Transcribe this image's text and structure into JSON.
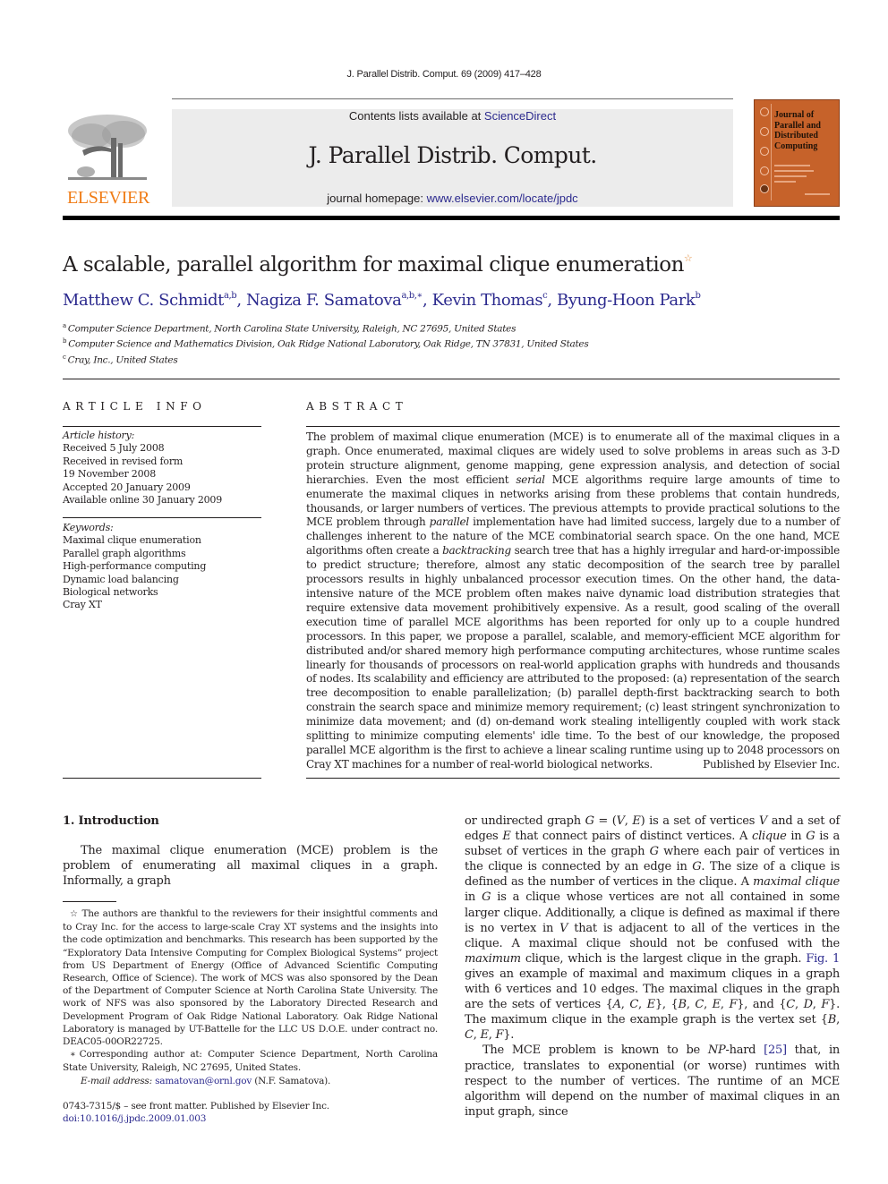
{
  "header": {
    "running_head": "J. Parallel Distrib. Comput. 69 (2009) 417–428",
    "contents_prefix": "Contents lists available at ",
    "contents_link": "ScienceDirect",
    "journal_title": "J. Parallel Distrib. Comput.",
    "homepage_prefix": "journal homepage: ",
    "homepage_link": "www.elsevier.com/locate/jpdc",
    "publisher_logo_text": "ELSEVIER",
    "cover_title_lines": [
      "Journal of",
      "Parallel and",
      "Distributed",
      "Computing"
    ]
  },
  "colors": {
    "link": "#2c2a8e",
    "elsevier_orange": "#f07c16",
    "cover_orange": "#c6622a",
    "banner_gray": "#ececec"
  },
  "article": {
    "title": "A scalable, parallel algorithm for maximal clique enumeration",
    "title_note_mark": "☆",
    "authors": [
      {
        "name": "Matthew C. Schmidt",
        "sup": "a,b"
      },
      {
        "name": "Nagiza F. Samatova",
        "sup": "a,b,∗"
      },
      {
        "name": "Kevin Thomas",
        "sup": "c"
      },
      {
        "name": "Byung-Hoon Park",
        "sup": "b"
      }
    ],
    "author_separator": ", ",
    "affiliations": [
      {
        "mark": "a",
        "text": "Computer Science Department, North Carolina State University, Raleigh, NC 27695, United States"
      },
      {
        "mark": "b",
        "text": "Computer Science and Mathematics Division, Oak Ridge National Laboratory, Oak Ridge, TN 37831, United States"
      },
      {
        "mark": "c",
        "text": "Cray, Inc., United States"
      }
    ]
  },
  "article_info": {
    "heading": "ARTICLE INFO",
    "history_label": "Article history:",
    "history": [
      "Received 5 July 2008",
      "Received in revised form",
      "19 November 2008",
      "Accepted 20 January 2009",
      "Available online 30 January 2009"
    ],
    "keywords_label": "Keywords:",
    "keywords": [
      "Maximal clique enumeration",
      "Parallel graph algorithms",
      "High-performance computing",
      "Dynamic load balancing",
      "Biological networks",
      "Cray XT"
    ]
  },
  "abstract": {
    "heading": "ABSTRACT",
    "segments": [
      {
        "t": "The problem of maximal clique enumeration (MCE) is to enumerate all of the maximal cliques in a graph. Once enumerated, maximal cliques are widely used to solve problems in areas such as 3-D protein structure alignment, genome mapping, gene expression analysis, and detection of social hierarchies. Even the most efficient "
      },
      {
        "t": "serial",
        "i": true
      },
      {
        "t": " MCE algorithms require large amounts of time to enumerate the maximal cliques in networks arising from these problems that contain hundreds, thousands, or larger numbers of vertices. The previous attempts to provide practical solutions to the MCE problem through "
      },
      {
        "t": "parallel",
        "i": true
      },
      {
        "t": " implementation have had limited success, largely due to a number of challenges inherent to the nature of the MCE combinatorial search space. On the one hand, MCE algorithms often create a "
      },
      {
        "t": "backtracking",
        "i": true
      },
      {
        "t": " search tree that has a highly irregular and hard-or-impossible to predict structure; therefore, almost any static decomposition of the search tree by parallel processors results in highly unbalanced processor execution times. On the other hand, the data-intensive nature of the MCE problem often makes naive dynamic load distribution strategies that require extensive data movement prohibitively expensive. As a result, good scaling of the overall execution time of parallel MCE algorithms has been reported for only up to a couple hundred processors. In this paper, we propose a parallel, scalable, and memory-efficient MCE algorithm for distributed and/or shared memory high performance computing architectures, whose runtime scales linearly for thousands of processors on real-world application graphs with hundreds and thousands of nodes. Its scalability and efficiency are attributed to the proposed: (a) representation of the search tree decomposition to enable parallelization; (b) parallel depth-first backtracking search to both constrain the search space and minimize memory requirement; (c) least stringent synchronization to minimize data movement; and (d) on-demand work stealing intelligently coupled with work stack splitting to minimize computing elements' idle time. To the best of our knowledge, the proposed parallel MCE algorithm is the first to achieve a linear scaling runtime using up to 2048 processors on Cray XT machines for a number of real-world biological networks."
      }
    ],
    "published_by": "Published by Elsevier Inc."
  },
  "introduction": {
    "heading": "1. Introduction",
    "left_paragraph": "The maximal clique enumeration (MCE) problem is the problem of enumerating all maximal cliques in a graph. Informally, a graph",
    "right_paragraph_1": [
      {
        "t": "or undirected graph "
      },
      {
        "t": "G",
        "i": true
      },
      {
        "t": " = ("
      },
      {
        "t": "V",
        "i": true
      },
      {
        "t": ", "
      },
      {
        "t": "E",
        "i": true
      },
      {
        "t": ") is a set of vertices "
      },
      {
        "t": "V",
        "i": true
      },
      {
        "t": " and a set of edges "
      },
      {
        "t": "E",
        "i": true
      },
      {
        "t": " that connect pairs of distinct vertices. A "
      },
      {
        "t": "clique",
        "i": true
      },
      {
        "t": " in "
      },
      {
        "t": "G",
        "i": true
      },
      {
        "t": " is a subset of vertices in the graph "
      },
      {
        "t": "G",
        "i": true
      },
      {
        "t": " where each pair of vertices in the clique is connected by an edge in "
      },
      {
        "t": "G",
        "i": true
      },
      {
        "t": ". The size of a clique is defined as the number of vertices in the clique. A "
      },
      {
        "t": "maximal clique",
        "i": true
      },
      {
        "t": " in "
      },
      {
        "t": "G",
        "i": true
      },
      {
        "t": " is a clique whose vertices are not all contained in some larger clique. Additionally, a clique is defined as maximal if there is no vertex in "
      },
      {
        "t": "V",
        "i": true
      },
      {
        "t": " that is adjacent to all of the vertices in the clique. A maximal clique should not be confused with the "
      },
      {
        "t": "maximum",
        "i": true
      },
      {
        "t": " clique, which is the largest clique in the graph. "
      },
      {
        "t": "Fig. 1",
        "link": true
      },
      {
        "t": " gives an example of maximal and maximum cliques in a graph with 6 vertices and 10 edges. The maximal cliques in the graph are the sets of vertices {"
      },
      {
        "t": "A",
        "i": true
      },
      {
        "t": ", "
      },
      {
        "t": "C",
        "i": true
      },
      {
        "t": ", "
      },
      {
        "t": "E",
        "i": true
      },
      {
        "t": "}, {"
      },
      {
        "t": "B",
        "i": true
      },
      {
        "t": ", "
      },
      {
        "t": "C",
        "i": true
      },
      {
        "t": ", "
      },
      {
        "t": "E",
        "i": true
      },
      {
        "t": ", "
      },
      {
        "t": "F",
        "i": true
      },
      {
        "t": "}, and {"
      },
      {
        "t": "C",
        "i": true
      },
      {
        "t": ", "
      },
      {
        "t": "D",
        "i": true
      },
      {
        "t": ", "
      },
      {
        "t": "F",
        "i": true
      },
      {
        "t": "}. The maximum clique in the example graph is the vertex set {"
      },
      {
        "t": "B",
        "i": true
      },
      {
        "t": ", "
      },
      {
        "t": "C",
        "i": true
      },
      {
        "t": ", "
      },
      {
        "t": "E",
        "i": true
      },
      {
        "t": ", "
      },
      {
        "t": "F",
        "i": true
      },
      {
        "t": "}."
      }
    ],
    "right_paragraph_2": [
      {
        "t": "The MCE problem is known to be "
      },
      {
        "t": "NP",
        "i": true
      },
      {
        "t": "-hard "
      },
      {
        "t": "[25]",
        "link": true
      },
      {
        "t": " that, in practice, translates to exponential (or worse) runtimes with respect to the number of vertices. The runtime of an MCE algorithm will depend on the number of maximal cliques in an input graph, since"
      }
    ]
  },
  "footnotes": {
    "star_mark": "☆",
    "star_text": "The authors are thankful to the reviewers for their insightful comments and to Cray Inc. for the access to large-scale Cray XT systems and the insights into the code optimization and benchmarks. This research has been supported by the “Exploratory Data Intensive Computing for Complex Biological Systems” project from US Department of Energy (Office of Advanced Scientific Computing Research, Office of Science). The work of MCS was also sponsored by the Dean of the Department of Computer Science at North Carolina State University. The work of NFS was also sponsored by the Laboratory Directed Research and Development Program of Oak Ridge National Laboratory. Oak Ridge National Laboratory is managed by UT-Battelle for the LLC US D.O.E. under contract no. DEAC05-00OR22725.",
    "corresponding_mark": "∗",
    "corresponding_text": "Corresponding author at: Computer Science Department, North Carolina State University, Raleigh, NC 27695, United States.",
    "email_label": "E-mail address:",
    "email": "samatovan@ornl.gov",
    "email_suffix": " (N.F. Samatova)."
  },
  "footer": {
    "front_matter": "0743-7315/$ – see front matter.  Published by Elsevier Inc.",
    "doi": "doi:10.1016/j.jpdc.2009.01.003"
  }
}
